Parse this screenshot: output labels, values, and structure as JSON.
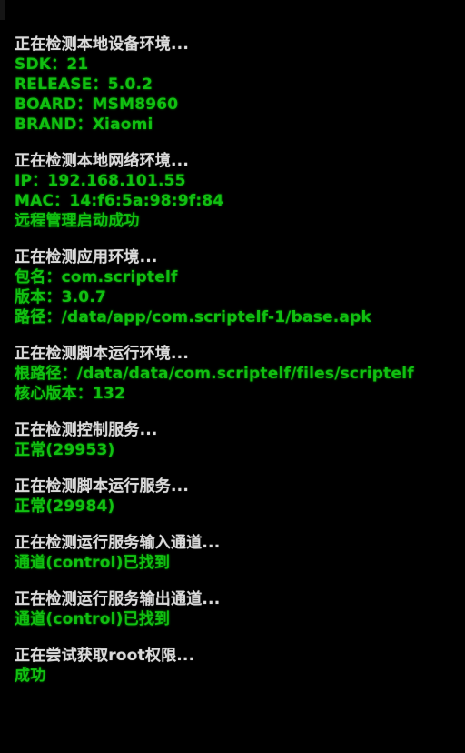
{
  "screen": {
    "background_color": "#000000",
    "status_text_color": "#d9d9d9",
    "result_text_color": "#11bf11"
  },
  "console": {
    "sections": [
      {
        "name": "device-environment",
        "status": "正在检测本地设备环境...",
        "results": [
          "SDK：21",
          "RELEASE：5.0.2",
          "BOARD：MSM8960",
          "BRAND：Xiaomi"
        ]
      },
      {
        "name": "network-environment",
        "status": "正在检测本地网络环境...",
        "results": [
          "IP：192.168.101.55",
          "MAC：14:f6:5a:98:9f:84",
          "远程管理启动成功"
        ]
      },
      {
        "name": "application-environment",
        "status": "正在检测应用环境...",
        "results": [
          "包名：com.scriptelf",
          "版本：3.0.7",
          "路径：/data/app/com.scriptelf-1/base.apk"
        ]
      },
      {
        "name": "script-runtime-environment",
        "status": "正在检测脚本运行环境...",
        "results": [
          "根路径：/data/data/com.scriptelf/files/scriptelf",
          "核心版本：132"
        ]
      },
      {
        "name": "control-service",
        "status": "正在检测控制服务...",
        "results": [
          "正常(29953)"
        ]
      },
      {
        "name": "script-run-service",
        "status": "正在检测脚本运行服务...",
        "results": [
          "正常(29984)"
        ]
      },
      {
        "name": "run-service-input-channel",
        "status": "正在检测运行服务输入通道...",
        "results": [
          "通道(control)已找到"
        ]
      },
      {
        "name": "run-service-output-channel",
        "status": "正在检测运行服务输出通道...",
        "results": [
          "通道(control)已找到"
        ]
      },
      {
        "name": "root-permission",
        "status": "正在尝试获取root权限...",
        "results": [
          "成功"
        ]
      }
    ]
  }
}
